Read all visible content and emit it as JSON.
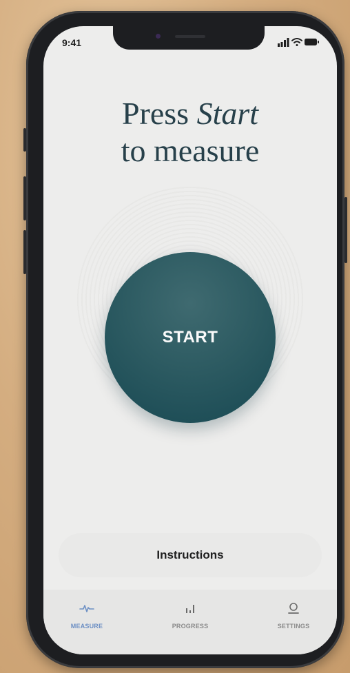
{
  "status_bar": {
    "time": "9:41",
    "icons": [
      "signal-icon",
      "wifi-icon",
      "battery-icon"
    ]
  },
  "headline": {
    "line1_prefix": "Press ",
    "line1_emphasis": "Start",
    "line2": "to measure"
  },
  "start_button": {
    "label": "START"
  },
  "instructions_button": {
    "label": "Instructions"
  },
  "tab_bar": {
    "tabs": [
      {
        "label": "MEASURE",
        "icon": "pulse-icon",
        "active": true
      },
      {
        "label": "PROGRESS",
        "icon": "bar-chart-icon",
        "active": false
      },
      {
        "label": "SETTINGS",
        "icon": "profile-icon",
        "active": false
      }
    ]
  },
  "colors": {
    "accent": "#2d5b62",
    "headline": "#27404a",
    "active_tab": "#6c8fc4",
    "inactive_tab": "#8a8a8a"
  }
}
